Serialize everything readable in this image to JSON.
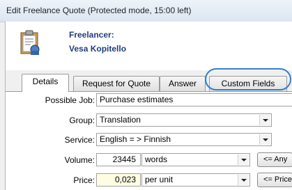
{
  "window": {
    "title": "Edit Freelance Quote (Protected mode, 15:00 left)"
  },
  "header": {
    "freelancer_label": "Freelancer:",
    "freelancer_name": "Vesa Kopitello",
    "icon": "clipboard-icon"
  },
  "tabs": [
    {
      "label": "Details",
      "active": true
    },
    {
      "label": "Request for Quote",
      "active": false
    },
    {
      "label": "Answer",
      "active": false
    },
    {
      "label": "Custom Fields",
      "active": false,
      "highlighted": true
    }
  ],
  "form": {
    "possible_job": {
      "label": "Possible Job:",
      "value": "Purchase estimates"
    },
    "group": {
      "label": "Group:",
      "value": "Translation"
    },
    "service": {
      "label": "Service:",
      "value": "English = > Finnish"
    },
    "volume": {
      "label": "Volume:",
      "value": "23445",
      "unit": "words",
      "button": "<= Any"
    },
    "price": {
      "label": "Price:",
      "value": "0,023",
      "unit": "per unit",
      "button": "<= Price"
    }
  },
  "colors": {
    "highlight": "#2f7fd0",
    "header_text": "#1f3d7a",
    "price_bg": "#fffde1"
  }
}
